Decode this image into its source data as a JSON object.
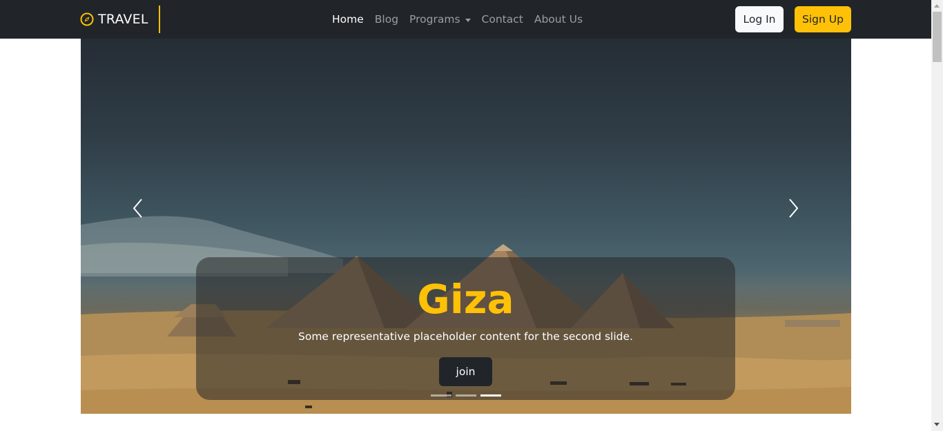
{
  "brand": {
    "name": "TRAVEL",
    "icon": "compass-icon",
    "accent": "#ffc107"
  },
  "nav": {
    "links": [
      {
        "label": "Home",
        "active": true
      },
      {
        "label": "Blog",
        "active": false
      },
      {
        "label": "Programs",
        "active": false,
        "dropdown": true
      },
      {
        "label": "Contact",
        "active": false
      },
      {
        "label": "About Us",
        "active": false
      }
    ]
  },
  "auth": {
    "login_label": "Log In",
    "signup_label": "Sign Up"
  },
  "carousel": {
    "title": "Giza",
    "text": "Some representative placeholder content for the second slide.",
    "button_label": "join",
    "slide_count": 3,
    "active_slide": 2,
    "prev_icon": "chevron-left-icon",
    "next_icon": "chevron-right-icon"
  },
  "colors": {
    "navbar": "#212529",
    "accent": "#ffc107",
    "button_dark": "#212529"
  }
}
